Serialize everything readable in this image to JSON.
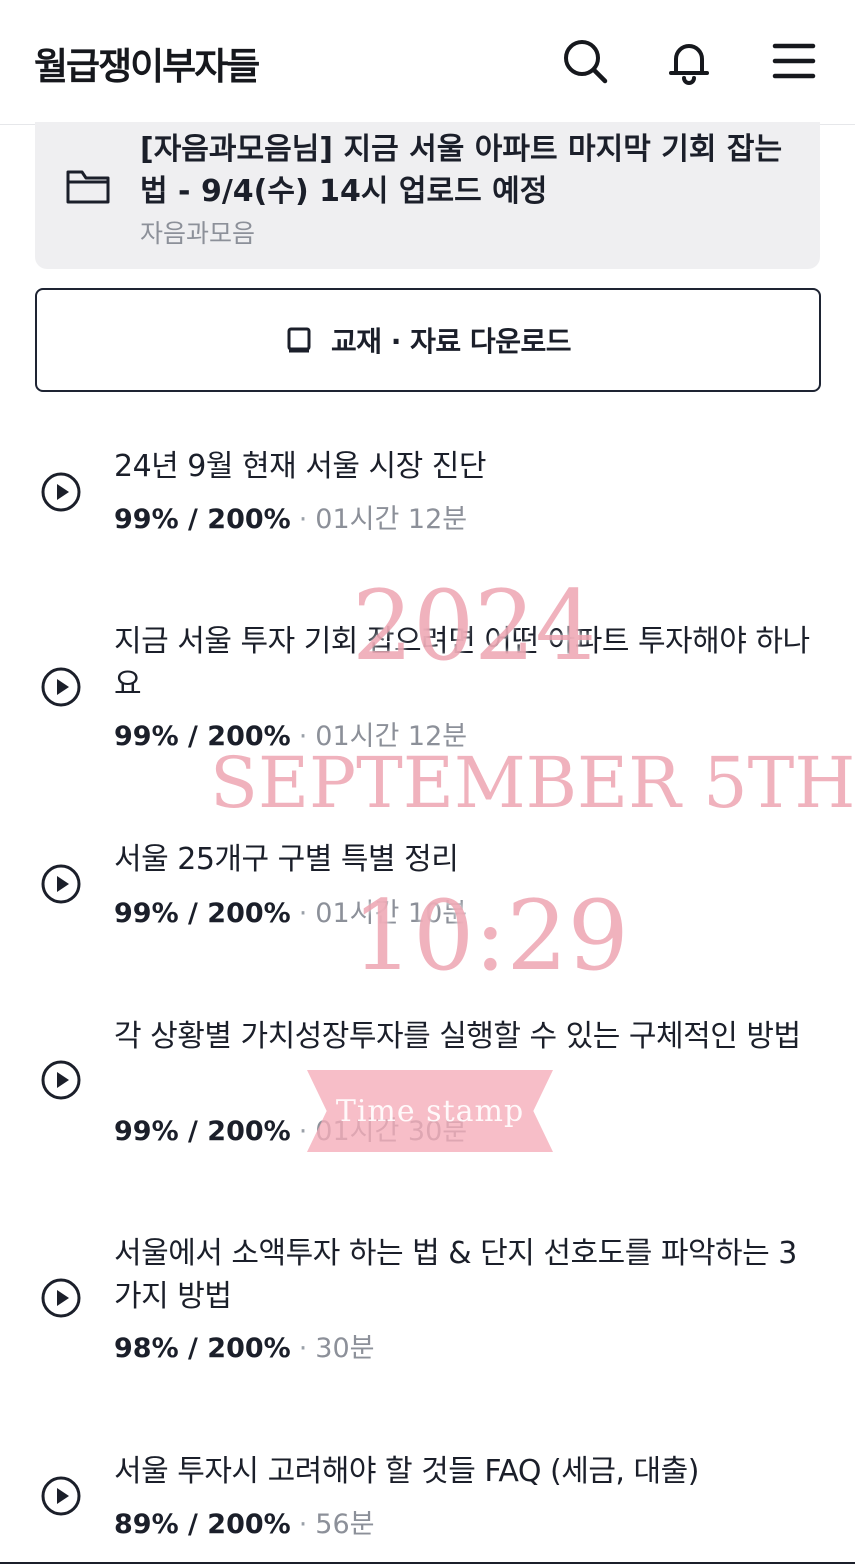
{
  "header": {
    "logo_text": "월급쟁이부자들",
    "icons": [
      "search-icon",
      "bell-icon",
      "menu-icon"
    ]
  },
  "banner": {
    "title": "[자음과모음님] 지금 서울 아파트 마지막 기회 잡는 법 - 9/4(수) 14시 업로드 예정",
    "subtitle": "자음과모음",
    "icon": "folder-icon"
  },
  "download_button": {
    "label": "교재 · 자료 다운로드",
    "icon": "book-icon"
  },
  "lessons": [
    {
      "title": "24년 9월 현재 서울 시장 진단",
      "progress": "99% / 200%",
      "duration": "01시간 12분"
    },
    {
      "title": "지금 서울 투자 기회 잡으려면 어떤 아파트 투자해야 하나요",
      "progress": "99% / 200%",
      "duration": "01시간 12분"
    },
    {
      "title": "서울 25개구 구별 특별 정리",
      "progress": "99% / 200%",
      "duration": "01시간 10분"
    },
    {
      "title": "각 상황별 가치성장투자를 실행할 수 있는 구체적인 방법",
      "progress": "99% / 200%",
      "duration": "01시간 30분"
    },
    {
      "title": "서울에서 소액투자 하는 법 & 단지 선호도를 파악하는 3가지 방법",
      "progress": "98% / 200%",
      "duration": "30분"
    },
    {
      "title": "서울 투자시 고려해야 할 것들 FAQ (세금, 대출)",
      "progress": "89% / 200%",
      "duration": "56분"
    }
  ],
  "separator": "·",
  "watermark": {
    "year": "2024",
    "date": "SEPTEMBER 5TH",
    "time": "10:29",
    "ribbon": "Time stamp",
    "color": "#ec9caa"
  }
}
